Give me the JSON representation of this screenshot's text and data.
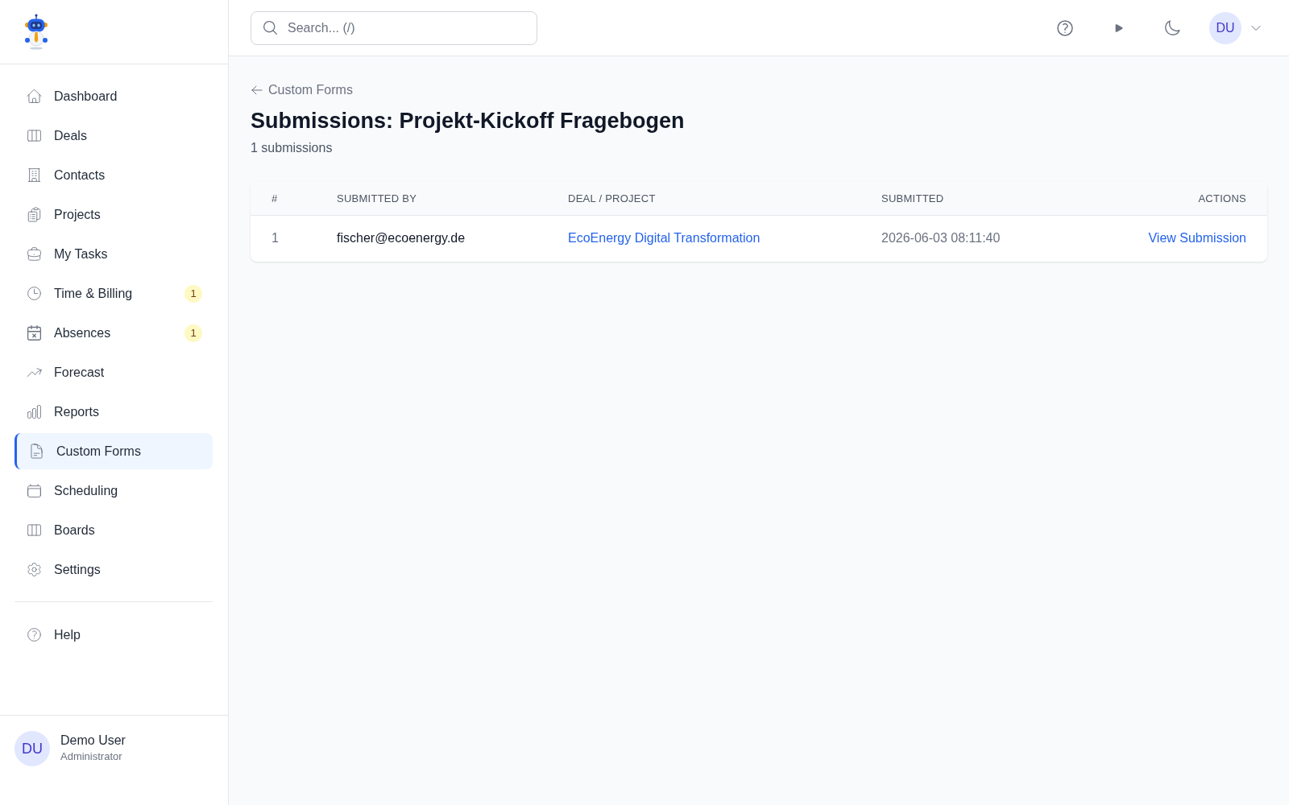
{
  "sidebar": {
    "items": [
      {
        "label": "Dashboard",
        "selected": false
      },
      {
        "label": "Deals",
        "selected": false
      },
      {
        "label": "Contacts",
        "selected": false
      },
      {
        "label": "Projects",
        "selected": false
      },
      {
        "label": "My Tasks",
        "selected": false
      },
      {
        "label": "Time & Billing",
        "selected": false,
        "badge": "1"
      },
      {
        "label": "Absences",
        "selected": false,
        "badge": "1"
      },
      {
        "label": "Forecast",
        "selected": false
      },
      {
        "label": "Reports",
        "selected": false
      },
      {
        "label": "Custom Forms",
        "selected": true
      },
      {
        "label": "Scheduling",
        "selected": false
      },
      {
        "label": "Boards",
        "selected": false
      },
      {
        "label": "Settings",
        "selected": false
      }
    ],
    "secondary_items": [
      {
        "label": "Help",
        "selected": false
      }
    ],
    "user": {
      "initials": "DU",
      "name": "Demo User",
      "role": "Administrator"
    }
  },
  "top_bar": {
    "search": {
      "placeholder": "Search... (/)"
    },
    "user_initials": "DU"
  },
  "page": {
    "back_link": "Custom Forms",
    "title": "Submissions: Projekt-Kickoff Fragebogen",
    "subtitle": "1 submissions"
  },
  "table": {
    "columns": [
      "#",
      "SUBMITTED BY",
      "DEAL / PROJECT",
      "SUBMITTED",
      "ACTIONS"
    ],
    "rows": [
      {
        "number": "1",
        "submitted_by": "fischer@ecoenergy.de",
        "deal_project": "EcoEnergy Digital Transformation",
        "submitted": "2026-06-03 08:11:40",
        "action": "View Submission"
      }
    ]
  }
}
